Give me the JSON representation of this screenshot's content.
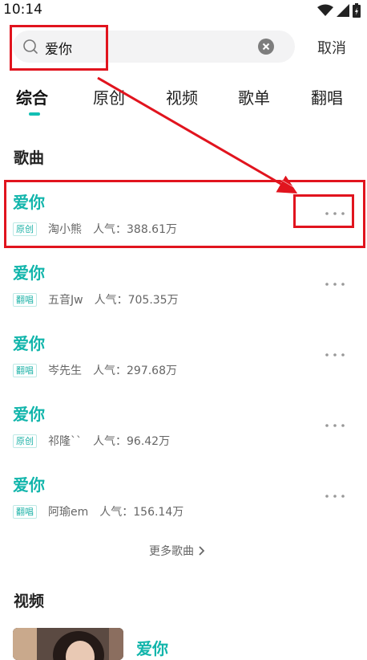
{
  "status_bar": {
    "time": "10:14"
  },
  "search": {
    "query": "爱你",
    "cancel_label": "取消"
  },
  "tabs": [
    {
      "label": "综合",
      "active": true
    },
    {
      "label": "原创"
    },
    {
      "label": "视频"
    },
    {
      "label": "歌单"
    },
    {
      "label": "翻唱"
    }
  ],
  "songs_section": {
    "title": "歌曲",
    "items": [
      {
        "title": "爱你",
        "badge": "原创",
        "artist": "淘小熊",
        "popularity": "人气：388.61万"
      },
      {
        "title": "爱你",
        "badge": "翻唱",
        "artist": "五音Jw",
        "popularity": "人气：705.35万"
      },
      {
        "title": "爱你",
        "badge": "翻唱",
        "artist": "岑先生",
        "popularity": "人气：297.68万"
      },
      {
        "title": "爱你",
        "badge": "原创",
        "artist": "祁隆``",
        "popularity": "人气：96.42万"
      },
      {
        "title": "爱你",
        "badge": "翻唱",
        "artist": "阿瑜em",
        "popularity": "人气：156.14万"
      }
    ],
    "more_label": "更多歌曲"
  },
  "videos_section": {
    "title": "视频",
    "items": [
      {
        "title": "爱你"
      }
    ]
  },
  "colors": {
    "accent": "#12b5ab",
    "annotation": "#e1141e"
  }
}
